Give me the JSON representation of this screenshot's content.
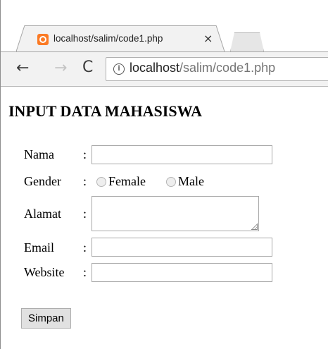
{
  "browser": {
    "tab": {
      "favicon": "xampp-favicon-icon",
      "title": "localhost/salim/code1.php",
      "close_glyph": "×"
    },
    "toolbar": {
      "back_glyph": "←",
      "forward_glyph": "→",
      "reload_glyph": "C",
      "info_glyph": "i",
      "url_host": "localhost",
      "url_path": "/salim/code1.php"
    }
  },
  "form": {
    "title": "INPUT DATA MAHASISWA",
    "fields": {
      "nama": {
        "label": "Nama",
        "colon": ":",
        "value": ""
      },
      "gender": {
        "label": "Gender",
        "colon": ":",
        "options": [
          "Female",
          "Male"
        ],
        "selected": null
      },
      "alamat": {
        "label": "Alamat",
        "colon": ":",
        "value": ""
      },
      "email": {
        "label": "Email",
        "colon": ":",
        "value": ""
      },
      "website": {
        "label": "Website",
        "colon": ":",
        "value": ""
      }
    },
    "submit_label": "Simpan"
  },
  "colors": {
    "favicon": "#fb7a24",
    "tab_bg": "#f2f2f2",
    "url_path": "#757575",
    "button_bg": "#e1e1e1"
  }
}
